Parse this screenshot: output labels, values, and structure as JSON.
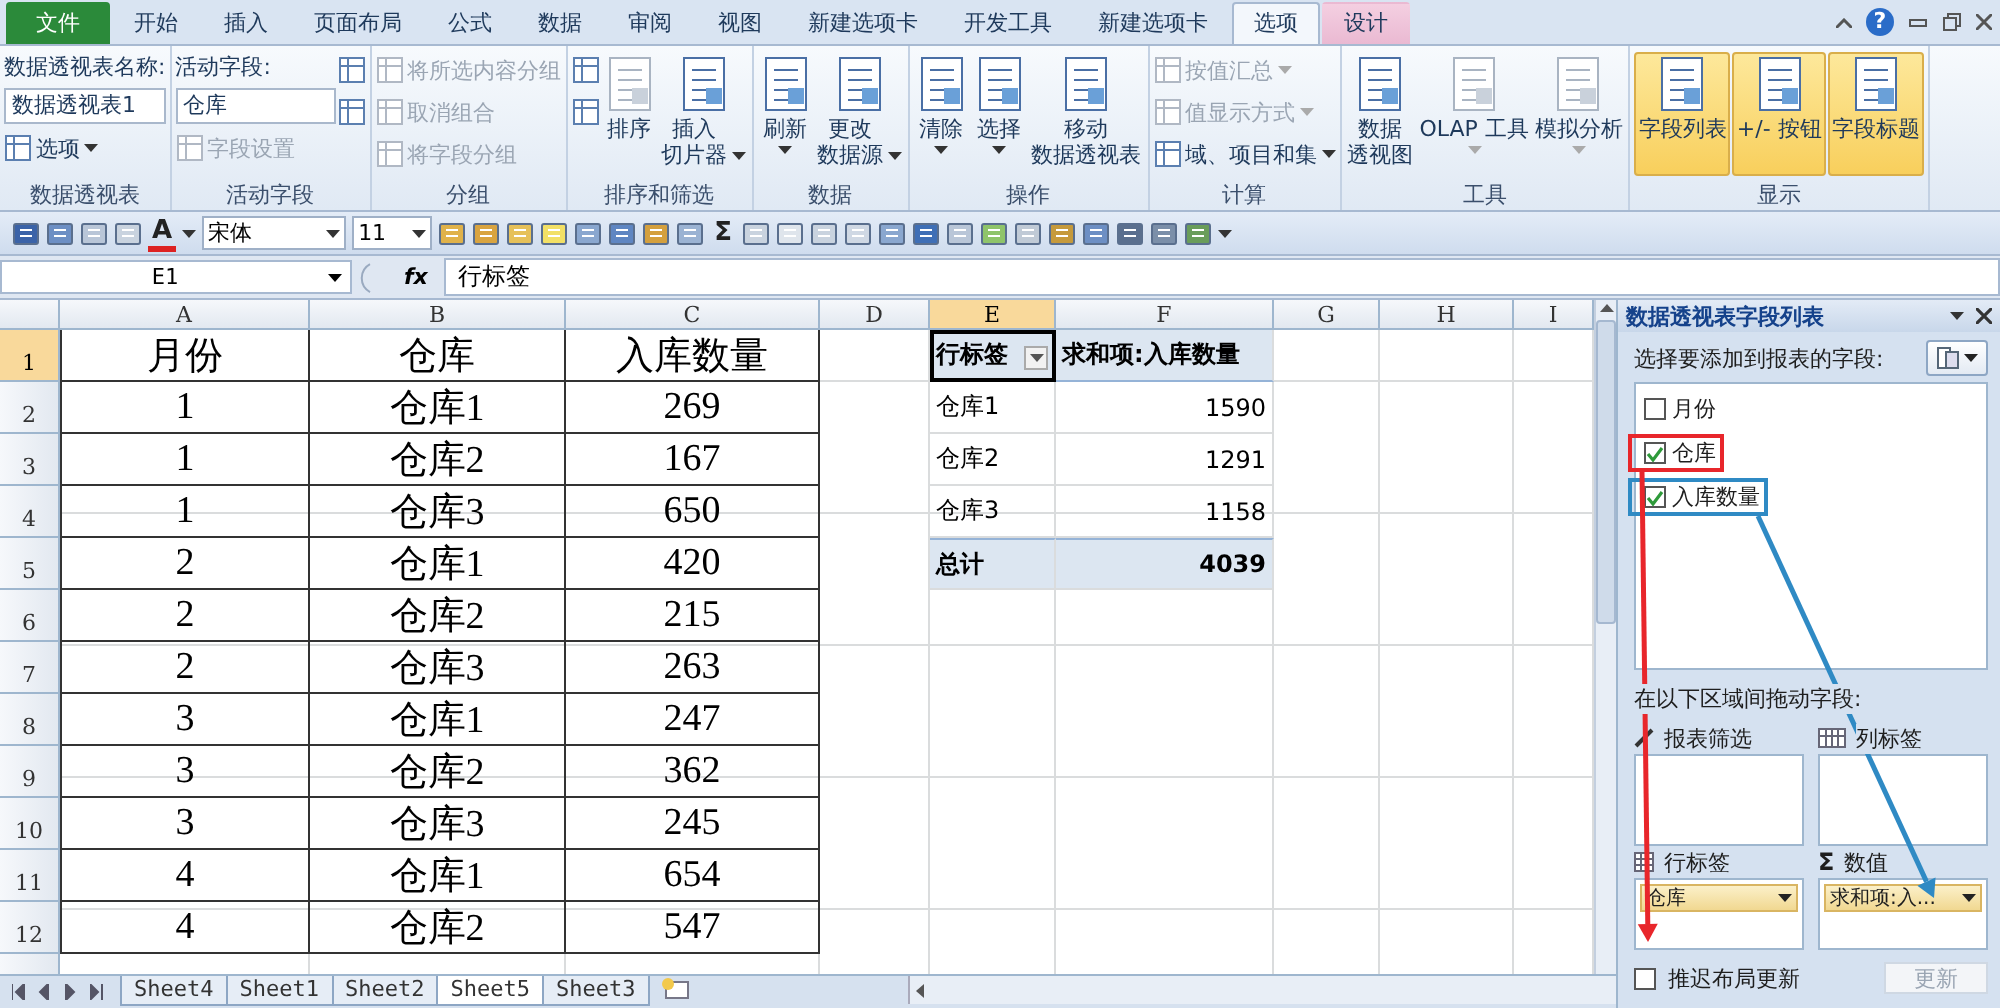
{
  "ribbon": {
    "tabs": [
      {
        "label": "文件",
        "kind": "file",
        "selected": false
      },
      {
        "label": "开始",
        "kind": "normal",
        "selected": false
      },
      {
        "label": "插入",
        "kind": "normal",
        "selected": false
      },
      {
        "label": "页面布局",
        "kind": "normal",
        "selected": false
      },
      {
        "label": "公式",
        "kind": "normal",
        "selected": false
      },
      {
        "label": "数据",
        "kind": "normal",
        "selected": false
      },
      {
        "label": "审阅",
        "kind": "normal",
        "selected": false
      },
      {
        "label": "视图",
        "kind": "normal",
        "selected": false
      },
      {
        "label": "新建选项卡",
        "kind": "normal",
        "selected": false
      },
      {
        "label": "开发工具",
        "kind": "normal",
        "selected": false
      },
      {
        "label": "新建选项卡",
        "kind": "normal",
        "selected": false
      },
      {
        "label": "选项",
        "kind": "contextual",
        "selected": true
      },
      {
        "label": "设计",
        "kind": "contextual",
        "selected": false
      }
    ],
    "help": "?",
    "groups": [
      {
        "label": "数据透视表",
        "columns": [
          [
            {
              "kind": "caption",
              "label": "数据透视表名称:"
            },
            {
              "kind": "field",
              "value": "数据透视表1"
            },
            {
              "kind": "small",
              "label": "选项",
              "dropdown": true,
              "disabled": false
            }
          ]
        ]
      },
      {
        "label": "活动字段",
        "columns": [
          [
            {
              "kind": "caption",
              "label": "活动字段:"
            },
            {
              "kind": "field",
              "value": "仓库"
            },
            {
              "kind": "small",
              "label": "字段设置",
              "dropdown": false,
              "disabled": true
            }
          ],
          [
            {
              "kind": "icon"
            },
            {
              "kind": "icon"
            }
          ]
        ]
      },
      {
        "label": "分组",
        "columns": [
          [
            {
              "kind": "small",
              "label": "将所选内容分组",
              "dropdown": false,
              "disabled": true
            },
            {
              "kind": "small",
              "label": "取消组合",
              "dropdown": false,
              "disabled": true
            },
            {
              "kind": "small",
              "label": "将字段分组",
              "dropdown": false,
              "disabled": true
            }
          ]
        ]
      },
      {
        "label": "排序和筛选",
        "columns": [
          [
            {
              "kind": "icon"
            },
            {
              "kind": "icon"
            }
          ],
          [
            {
              "kind": "large",
              "label": "排序",
              "dropdown": false,
              "disabled": true,
              "on": false
            }
          ],
          [
            {
              "kind": "large",
              "lines": [
                "插入",
                "切片器"
              ],
              "dropdown": true,
              "disabled": false,
              "on": false
            }
          ]
        ]
      },
      {
        "label": "数据",
        "columns": [
          [
            {
              "kind": "large",
              "label": "刷新",
              "dropdown": true,
              "disabled": false,
              "on": false
            }
          ],
          [
            {
              "kind": "large",
              "lines": [
                "更改",
                "数据源"
              ],
              "dropdown": true,
              "disabled": false,
              "on": false
            }
          ]
        ]
      },
      {
        "label": "操作",
        "columns": [
          [
            {
              "kind": "large",
              "label": "清除",
              "dropdown": true,
              "disabled": false,
              "on": false
            }
          ],
          [
            {
              "kind": "large",
              "label": "选择",
              "dropdown": true,
              "disabled": false,
              "on": false
            }
          ],
          [
            {
              "kind": "large",
              "lines": [
                "移动",
                "数据透视表"
              ],
              "dropdown": false,
              "disabled": false,
              "on": false
            }
          ]
        ]
      },
      {
        "label": "计算",
        "columns": [
          [
            {
              "kind": "small",
              "label": "按值汇总",
              "dropdown": true,
              "disabled": true
            },
            {
              "kind": "small",
              "label": "值显示方式",
              "dropdown": true,
              "disabled": true
            },
            {
              "kind": "small",
              "label": "域、项目和集",
              "dropdown": true,
              "disabled": false
            }
          ]
        ]
      },
      {
        "label": "工具",
        "columns": [
          [
            {
              "kind": "large",
              "lines": [
                "数据",
                "透视图"
              ],
              "dropdown": false,
              "disabled": false,
              "on": false
            }
          ],
          [
            {
              "kind": "large",
              "label": "OLAP 工具",
              "dropdown": true,
              "disabled": true,
              "on": false
            }
          ],
          [
            {
              "kind": "large",
              "label": "模拟分析",
              "dropdown": true,
              "disabled": true,
              "on": false
            }
          ]
        ]
      },
      {
        "label": "显示",
        "columns": [
          [
            {
              "kind": "large",
              "label": "字段列表",
              "dropdown": false,
              "disabled": false,
              "on": true
            }
          ],
          [
            {
              "kind": "large",
              "label": "+/- 按钮",
              "dropdown": false,
              "disabled": false,
              "on": true
            }
          ],
          [
            {
              "kind": "large",
              "label": "字段标题",
              "dropdown": false,
              "disabled": false,
              "on": true
            }
          ]
        ]
      }
    ]
  },
  "toolbar": {
    "font": "宋体",
    "size": "11",
    "font_color_glyph": "A",
    "sum_glyph": "Σ"
  },
  "formula_bar": {
    "name_box": "E1",
    "fx": "fx",
    "formula": "行标签"
  },
  "sheet": {
    "columns": [
      {
        "label": "A",
        "selected": false
      },
      {
        "label": "B",
        "selected": false
      },
      {
        "label": "C",
        "selected": false
      },
      {
        "label": "D",
        "selected": false
      },
      {
        "label": "E",
        "selected": true
      },
      {
        "label": "F",
        "selected": false
      },
      {
        "label": "G",
        "selected": false
      },
      {
        "label": "H",
        "selected": false
      },
      {
        "label": "I",
        "selected": false
      }
    ],
    "rows": [
      {
        "label": "1",
        "selected": true
      },
      {
        "label": "2",
        "selected": false
      },
      {
        "label": "3",
        "selected": false
      },
      {
        "label": "4",
        "selected": false
      },
      {
        "label": "5",
        "selected": false
      },
      {
        "label": "6",
        "selected": false
      },
      {
        "label": "7",
        "selected": false
      },
      {
        "label": "8",
        "selected": false
      },
      {
        "label": "9",
        "selected": false
      },
      {
        "label": "10",
        "selected": false
      },
      {
        "label": "11",
        "selected": false
      },
      {
        "label": "12",
        "selected": false
      }
    ],
    "data_table": {
      "columns": [
        "月份",
        "仓库",
        "入库数量"
      ],
      "rows": [
        [
          "1",
          "仓库1",
          "269"
        ],
        [
          "1",
          "仓库2",
          "167"
        ],
        [
          "1",
          "仓库3",
          "650"
        ],
        [
          "2",
          "仓库1",
          "420"
        ],
        [
          "2",
          "仓库2",
          "215"
        ],
        [
          "2",
          "仓库3",
          "263"
        ],
        [
          "3",
          "仓库1",
          "247"
        ],
        [
          "3",
          "仓库2",
          "362"
        ],
        [
          "3",
          "仓库3",
          "245"
        ],
        [
          "4",
          "仓库1",
          "654"
        ],
        [
          "4",
          "仓库2",
          "547"
        ]
      ]
    },
    "pivot": {
      "row_header": "行标签",
      "value_header": "求和项:入库数量",
      "header_selected": true,
      "rows": [
        [
          "仓库1",
          "1590"
        ],
        [
          "仓库2",
          "1291"
        ],
        [
          "仓库3",
          "1158"
        ]
      ],
      "total": [
        "总计",
        "4039"
      ]
    }
  },
  "sheet_tabs": [
    {
      "label": "Sheet4",
      "selected": false
    },
    {
      "label": "Sheet1",
      "selected": false
    },
    {
      "label": "Sheet2",
      "selected": false
    },
    {
      "label": "Sheet5",
      "selected": true
    },
    {
      "label": "Sheet3",
      "selected": false
    }
  ],
  "field_list": {
    "title": "数据透视表字段列表",
    "prompt": "选择要添加到报表的字段:",
    "fields": [
      {
        "label": "月份",
        "checked": false
      },
      {
        "label": "仓库",
        "checked": true,
        "color": "#e8262b"
      },
      {
        "label": "入库数量",
        "checked": true,
        "color": "#2f8ac4"
      }
    ],
    "drag_prompt": "在以下区域间拖动字段:",
    "areas": [
      {
        "kind": "filter",
        "label": "报表筛选"
      },
      {
        "kind": "columns",
        "label": "列标签"
      },
      {
        "kind": "rows",
        "label": "行标签",
        "items": [
          "仓库"
        ],
        "color": "#e8262b"
      },
      {
        "kind": "values",
        "label": "数值",
        "glyph": "Σ",
        "items": [
          "求和项:入..."
        ],
        "color": "#2f8ac4"
      }
    ],
    "defer": {
      "label": "推迟布局更新",
      "checked": false
    },
    "update_button": {
      "label": "更新",
      "disabled": true
    }
  }
}
